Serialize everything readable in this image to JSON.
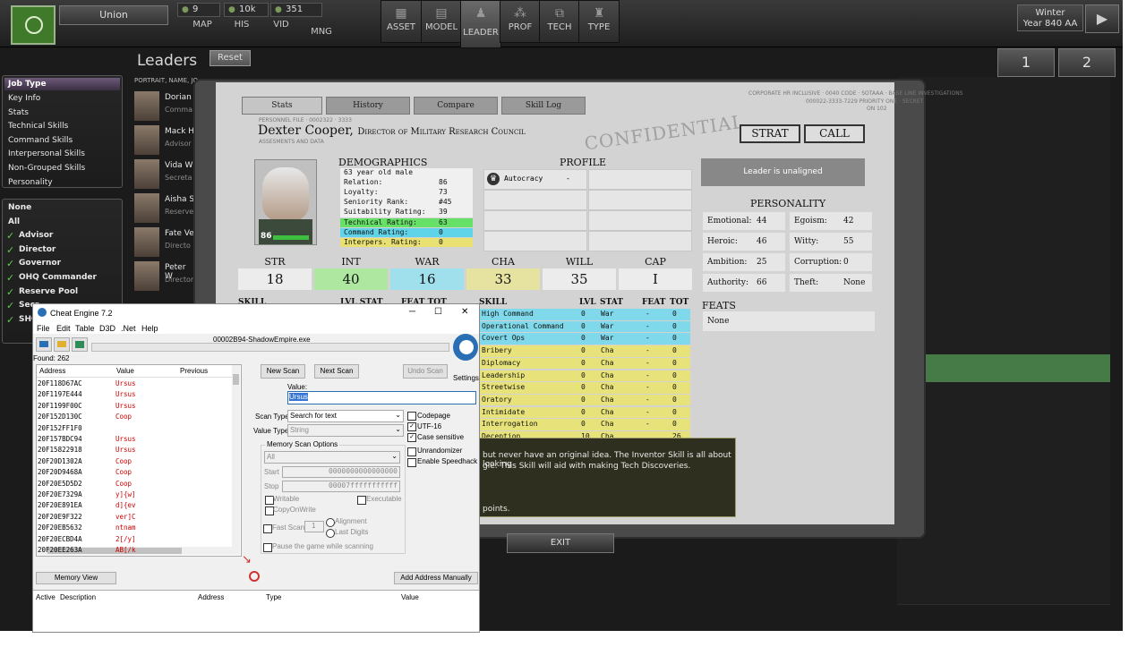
{
  "topbar": {
    "nation": "Union",
    "res1": "9",
    "res2": "10k",
    "res3": "351",
    "nav": [
      "MAP",
      "HIS",
      "VID",
      "MNG"
    ],
    "big": [
      {
        "label": "ASSET",
        "icon": "▦"
      },
      {
        "label": "MODEL",
        "icon": "▤"
      },
      {
        "label": "LEADER",
        "icon": "♟"
      },
      {
        "label": "PROF",
        "icon": "⁂"
      },
      {
        "label": "TECH",
        "icon": "⧉"
      },
      {
        "label": "TYPE",
        "icon": "♜"
      }
    ],
    "season": "Winter",
    "year": "Year 840 AA",
    "play_icon": "▶"
  },
  "left": {
    "job_type": "Job Type",
    "job_items": [
      "Key Info",
      "Stats",
      "Technical Skills",
      "Command Skills",
      "Interpersonal Skills",
      "Non-Grouped Skills",
      "Personality"
    ],
    "filter_items": [
      "None",
      "All"
    ],
    "checked_items": [
      "Advisor",
      "Director",
      "Governor",
      "OHQ Commander",
      "Reserve Pool",
      "Secr",
      "SHQ"
    ]
  },
  "leaders": {
    "title": "Leaders",
    "reset": "Reset",
    "col_header": "PORTRAIT, NAME, JO",
    "page1": "1",
    "page2": "2",
    "rows": [
      {
        "name": "Dorian",
        "role": "Comma"
      },
      {
        "name": "Mack H",
        "role": "Advisor"
      },
      {
        "name": "Vida W",
        "role": "Secreta"
      },
      {
        "name": "Aisha S",
        "role": "Reserve"
      },
      {
        "name": "Fate Ve",
        "role": "Directo"
      },
      {
        "name": "Peter W",
        "role": "Director"
      }
    ]
  },
  "dossier": {
    "tabs": [
      "Stats",
      "History",
      "Compare",
      "Skill Log"
    ],
    "personnel": "PERSONNEL FILE · 0002322 · 3333",
    "assess": "ASSESMENTS AND DATA",
    "corp1": "CORPORATE HR INCLUSIVE · 0040 CODE · SOTAAA · BASE LINE INVESTIGATIONS",
    "corp2": "000022-3333-7229 PRIORITY ONE · SECRET",
    "corp3": "ON 102",
    "name": "Dexter Cooper,",
    "title": "Director of Military Research Council",
    "confidential": "CONFIDENTIAL",
    "strat": "STRAT",
    "call": "CALL",
    "level": "86",
    "demographics_header": "DEMOGRAPHICS",
    "age": "63 year old male",
    "demo": [
      {
        "label": "Relation:",
        "value": "86"
      },
      {
        "label": "Loyalty:",
        "value": "73"
      },
      {
        "label": "Seniority Rank:",
        "value": "#45"
      },
      {
        "label": "Suitability Rating:",
        "value": "39"
      }
    ],
    "tech_label": "Technical Rating:",
    "tech_value": "63",
    "cmd_label": "Command Rating:",
    "cmd_value": "0",
    "inter_label": "Interpers. Rating:",
    "inter_value": "0",
    "profile_header": "PROFILE",
    "profile_icon": "crown-icon",
    "profile_label": "Autocracy",
    "profile_value": "-",
    "attrs": [
      {
        "name": "STR",
        "value": "18"
      },
      {
        "name": "INT",
        "value": "40"
      },
      {
        "name": "WAR",
        "value": "16"
      },
      {
        "name": "CHA",
        "value": "33"
      },
      {
        "name": "WILL",
        "value": "35"
      },
      {
        "name": "CAP",
        "value": "I"
      }
    ],
    "aligned": "Leader is unaligned",
    "personality_header": "PERSONALITY",
    "personality": [
      {
        "label": "Emotional:",
        "value": "44"
      },
      {
        "label": "Egoism:",
        "value": "42"
      },
      {
        "label": "Heroic:",
        "value": "46"
      },
      {
        "label": "Witty:",
        "value": "55"
      },
      {
        "label": "Ambition:",
        "value": "25"
      },
      {
        "label": "Corruption:",
        "value": "0"
      },
      {
        "label": "Authority:",
        "value": "66"
      },
      {
        "label": "Theft:",
        "value": "None"
      }
    ],
    "feats_header": "FEATS",
    "feats_value": "None",
    "skill_hdr_left": "SKILL",
    "lvl_stat_left": "LVL STAT",
    "feat_tot_left": "FEAT TOT",
    "skill_hdr": "SKILL",
    "lvl_hdr": "LVL",
    "stat_hdr": "STAT",
    "feat_hdr": "FEAT",
    "tot_hdr": "TOT",
    "skills": [
      {
        "name": "High Command",
        "lvl": "0",
        "stat": "War",
        "feat": "-",
        "tot": "0"
      },
      {
        "name": "Operational Command",
        "lvl": "0",
        "stat": "War",
        "feat": "-",
        "tot": "0"
      },
      {
        "name": "Covert Ops",
        "lvl": "0",
        "stat": "War",
        "feat": "-",
        "tot": "0"
      },
      {
        "name": "Bribery",
        "lvl": "0",
        "stat": "Cha",
        "feat": "-",
        "tot": "0"
      },
      {
        "name": "Diplomacy",
        "lvl": "0",
        "stat": "Cha",
        "feat": "-",
        "tot": "0"
      },
      {
        "name": "Leadership",
        "lvl": "0",
        "stat": "Cha",
        "feat": "-",
        "tot": "0"
      },
      {
        "name": "Streetwise",
        "lvl": "0",
        "stat": "Cha",
        "feat": "-",
        "tot": "0"
      },
      {
        "name": "Oratory",
        "lvl": "0",
        "stat": "Cha",
        "feat": "-",
        "tot": "0"
      },
      {
        "name": "Intimidate",
        "lvl": "0",
        "stat": "Cha",
        "feat": "-",
        "tot": "0"
      },
      {
        "name": "Interrogation",
        "lvl": "0",
        "stat": "Cha",
        "feat": "-",
        "tot": "0"
      },
      {
        "name": "Deception",
        "lvl": "10",
        "stat": "Cha",
        "feat": "",
        "tot": "26"
      }
    ],
    "tooltip_line1": "but never have an original idea. The Inventor Skill is all about looking",
    "tooltip_line2": "gle. This Skill will aid with making Tech Discoveries.",
    "tooltip_line3": "points.",
    "exit": "EXIT"
  },
  "ce": {
    "title": "Cheat Engine 7.2",
    "minimize": "─",
    "maximize": "☐",
    "close": "✕",
    "menus": [
      "File",
      "Edit",
      "Table",
      "D3D",
      ".Net",
      "Help"
    ],
    "process": "00002B94-ShadowEmpire.exe",
    "found": "Found: 262",
    "col_address": "Address",
    "col_value": "Value",
    "col_previous": "Previous",
    "results": [
      {
        "a": "20F118D67AC",
        "v": "Ursus"
      },
      {
        "a": "20F1197E444",
        "v": "Ursus"
      },
      {
        "a": "20F1199F00C",
        "v": "Ursus"
      },
      {
        "a": "20F152D130C",
        "v": "Coop"
      },
      {
        "a": "20F152FF1F0",
        "v": ""
      },
      {
        "a": "20F157BDC94",
        "v": "Ursus"
      },
      {
        "a": "20F15822918",
        "v": "Ursus"
      },
      {
        "a": "20F20D1302A",
        "v": "Coop"
      },
      {
        "a": "20F20D9468A",
        "v": "Coop"
      },
      {
        "a": "20F20E5D5D2",
        "v": "Coop"
      },
      {
        "a": "20F20E7329A",
        "v": "y]{w]"
      },
      {
        "a": "20F20E891EA",
        "v": "d]{ev"
      },
      {
        "a": "20F20E9F322",
        "v": "ver]C"
      },
      {
        "a": "20F20EB5632",
        "v": "ntnam"
      },
      {
        "a": "20F20ECBD4A",
        "v": "2[/y]"
      },
      {
        "a": "20F20EE263A",
        "v": "AB[/k"
      }
    ],
    "new_scan": "New Scan",
    "next_scan": "Next Scan",
    "undo_scan": "Undo Scan",
    "settings": "Settings",
    "value_label": "Value:",
    "value": "Ursus",
    "scan_type_label": "Scan Type",
    "scan_type": "Search for text",
    "value_type_label": "Value Type",
    "value_type": "String",
    "msopt": "Memory Scan Options",
    "region": "All",
    "start_label": "Start",
    "start": "0000000000000000",
    "stop_label": "Stop",
    "stop": "00007fffffffffff",
    "writable": "Writable",
    "executable": "Executable",
    "copyonwrite": "CopyOnWrite",
    "fastscan": "Fast Scan",
    "fastscan_val": "1",
    "alignment": "Alignment",
    "lastdigits": "Last Digits",
    "pause": "Pause the game while scanning",
    "codepage": "Codepage",
    "utf16": "UTF-16",
    "case": "Case sensitive",
    "unrandomizer": "Unrandomizer",
    "speedhack": "Enable Speedhack",
    "memview": "Memory View",
    "addmanual": "Add Address Manually",
    "bot_active": "Active",
    "bot_desc": "Description",
    "bot_addr": "Address",
    "bot_type": "Type",
    "bot_value": "Value"
  }
}
